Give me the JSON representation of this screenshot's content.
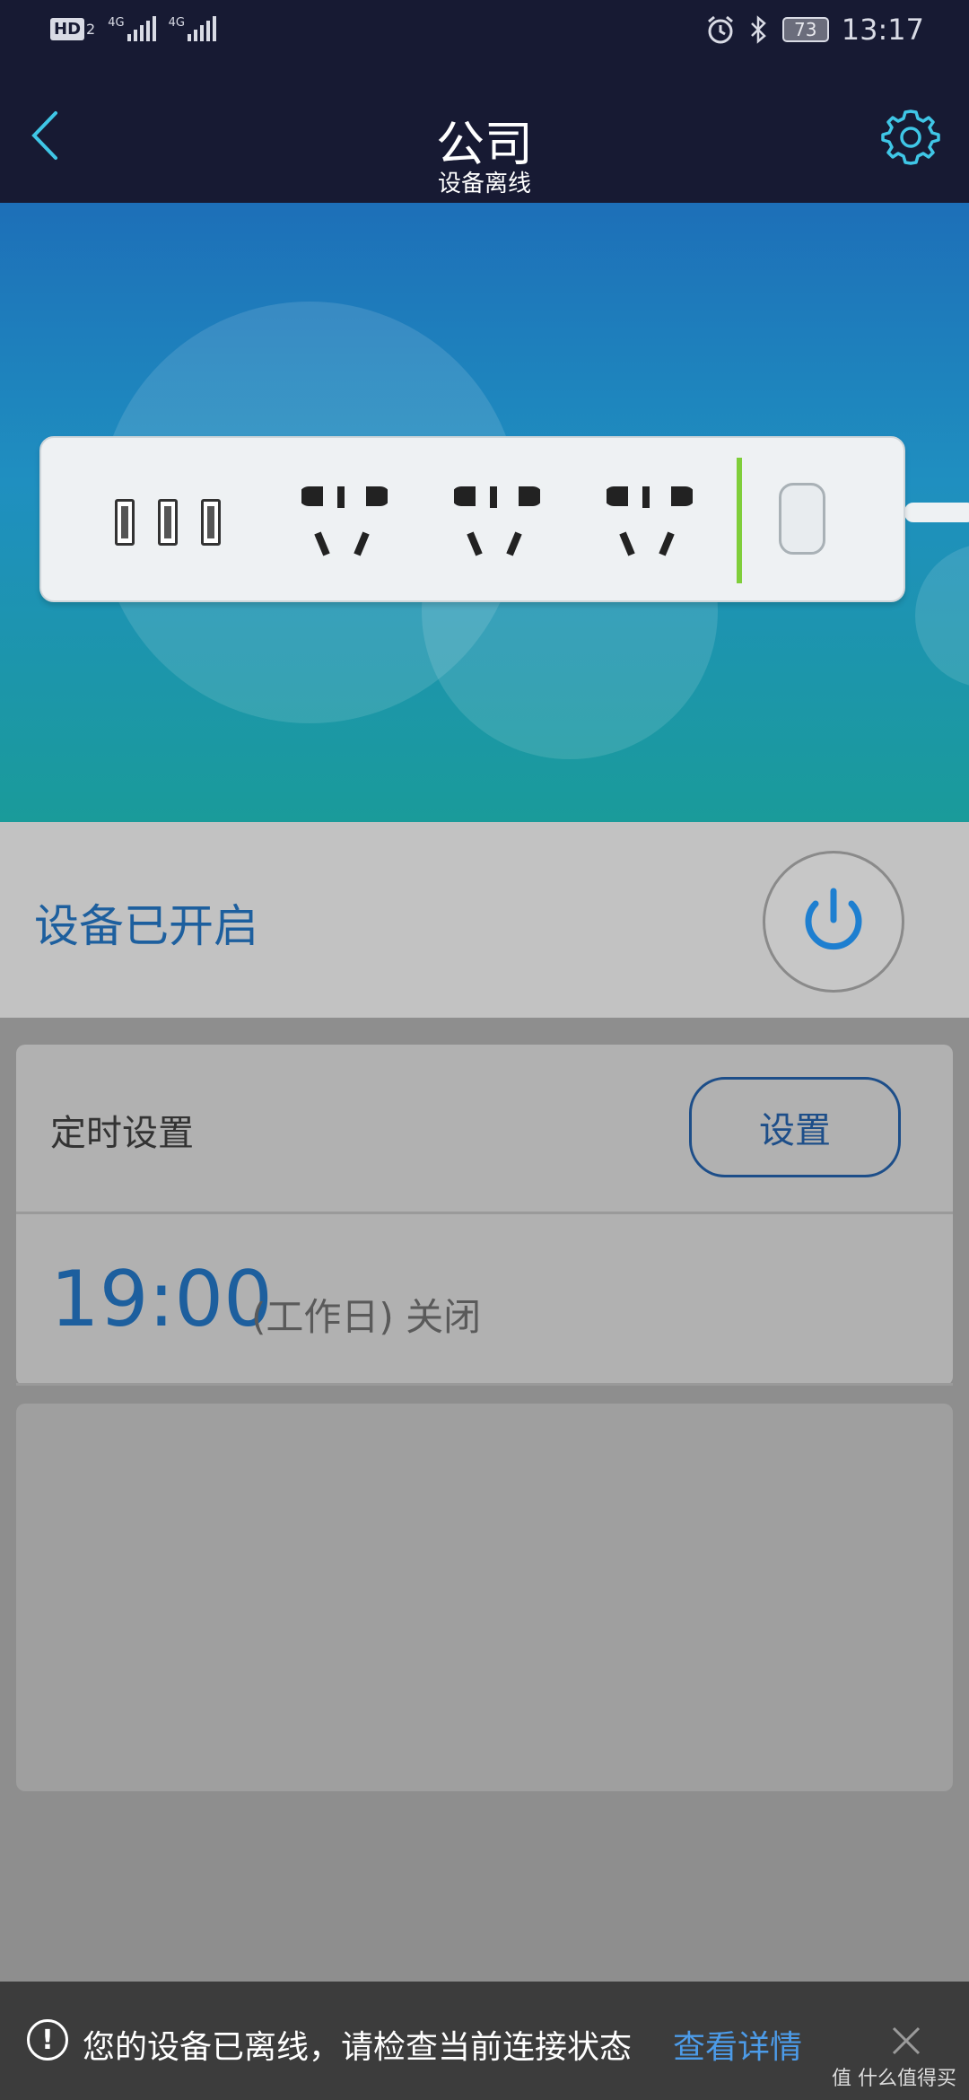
{
  "status_bar": {
    "hd": "HD",
    "hd_sub": "2",
    "net1": "4G",
    "net2": "4G",
    "battery": "73",
    "time": "13:17",
    "icons": [
      "alarm-icon",
      "bluetooth-icon"
    ]
  },
  "header": {
    "title": "公司",
    "subtitle": "设备离线"
  },
  "power": {
    "label": "设备已开启"
  },
  "timer": {
    "header_label": "定时设置",
    "button_label": "设置",
    "entry_time": "19:00",
    "entry_desc": "(工作日) 关闭"
  },
  "notification": {
    "icon": "!",
    "message": "您的设备已离线，请检查当前连接状态",
    "link": "查看详情"
  },
  "watermark": "值 什么值得买",
  "colors": {
    "header_bg": "#171a33",
    "accent_blue": "#1d5f9e",
    "link_blue": "#4c9be8",
    "indicator_green": "#7fce3a"
  }
}
